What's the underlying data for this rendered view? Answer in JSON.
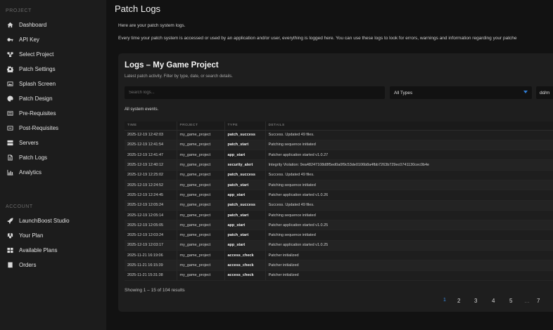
{
  "sidebar": {
    "project_label": "PROJECT",
    "project_items": [
      {
        "label": "Dashboard",
        "icon": "home-icon"
      },
      {
        "label": "API Key",
        "icon": "key-icon"
      },
      {
        "label": "Select Project",
        "icon": "project-icon"
      },
      {
        "label": "Patch Settings",
        "icon": "gear-icon"
      },
      {
        "label": "Splash Screen",
        "icon": "image-icon"
      },
      {
        "label": "Patch Design",
        "icon": "palette-icon"
      },
      {
        "label": "Pre-Requisites",
        "icon": "list-icon"
      },
      {
        "label": "Post-Requisites",
        "icon": "list-check-icon"
      },
      {
        "label": "Servers",
        "icon": "server-icon"
      },
      {
        "label": "Patch Logs",
        "icon": "file-icon"
      },
      {
        "label": "Analytics",
        "icon": "chart-icon"
      }
    ],
    "account_label": "ACCOUNT",
    "account_items": [
      {
        "label": "LaunchBoost Studio",
        "icon": "rocket-icon"
      },
      {
        "label": "Your Plan",
        "icon": "badge-icon"
      },
      {
        "label": "Available Plans",
        "icon": "layers-icon"
      },
      {
        "label": "Orders",
        "icon": "receipt-icon"
      }
    ]
  },
  "main": {
    "title": "Patch Logs",
    "intro1": "Here are your patch system logs.",
    "intro2": "Every time your patch system is accessed or used by an application and/or user, everything is logged here. You can use these logs to look for errors, warnings and information regarding your patche"
  },
  "card": {
    "title": "Logs – My Game Project",
    "subtitle": "Latest patch activity. Filter by type, date, or search details.",
    "search_placeholder": "Search logs...",
    "type_filter": "All Types",
    "date_filter": "dd/m",
    "events_label": "All system events.",
    "columns": [
      "TIME",
      "PROJECT",
      "TYPE",
      "DETAILS"
    ],
    "rows": [
      [
        "2025-12-19 12:42:03",
        "my_game_project",
        "patch_success",
        "Success. Updated 49 files."
      ],
      [
        "2025-12-19 12:41:54",
        "my_game_project",
        "patch_start",
        "Patching sequence initiated"
      ],
      [
        "2025-12-19 12:41:47",
        "my_game_project",
        "app_start",
        "Patcher application started v1.0.27"
      ],
      [
        "2025-12-19 12:40:12",
        "my_game_project",
        "security_alert",
        "Integrity Violation: 9ea48247108d8f5ed0a0f9c53de0106b8a4fbb7263b729ec0741130cec0b4e"
      ],
      [
        "2025-12-19 12:25:02",
        "my_game_project",
        "patch_success",
        "Success. Updated 49 files."
      ],
      [
        "2025-12-19 12:24:52",
        "my_game_project",
        "patch_start",
        "Patching sequence initiated"
      ],
      [
        "2025-12-19 12:24:45",
        "my_game_project",
        "app_start",
        "Patcher application started v1.0.26"
      ],
      [
        "2025-12-19 12:05:24",
        "my_game_project",
        "patch_success",
        "Success. Updated 49 files."
      ],
      [
        "2025-12-19 12:05:14",
        "my_game_project",
        "patch_start",
        "Patching sequence initiated"
      ],
      [
        "2025-12-19 12:05:05",
        "my_game_project",
        "app_start",
        "Patcher application started v1.0.25"
      ],
      [
        "2025-12-19 12:03:24",
        "my_game_project",
        "patch_start",
        "Patching sequence initiated"
      ],
      [
        "2025-12-19 12:03:17",
        "my_game_project",
        "app_start",
        "Patcher application started v1.0.25"
      ],
      [
        "2025-11-21 16:19:06",
        "my_game_project",
        "access_check",
        "Patcher initialized"
      ],
      [
        "2025-11-21 16:15:39",
        "my_game_project",
        "access_check",
        "Patcher initialized"
      ],
      [
        "2025-11-21 15:31:38",
        "my_game_project",
        "access_check",
        "Patcher initialized"
      ]
    ],
    "showing": "Showing 1 – 15 of 104 results",
    "pages": [
      "1",
      "2",
      "3",
      "4",
      "5",
      "…",
      "7"
    ],
    "active_page": "1"
  },
  "colors": {
    "accent": "#2f7dd6",
    "sidebar_bg": "#1c1c1c",
    "main_bg": "#121212",
    "card_bg": "#1e1e1e"
  }
}
